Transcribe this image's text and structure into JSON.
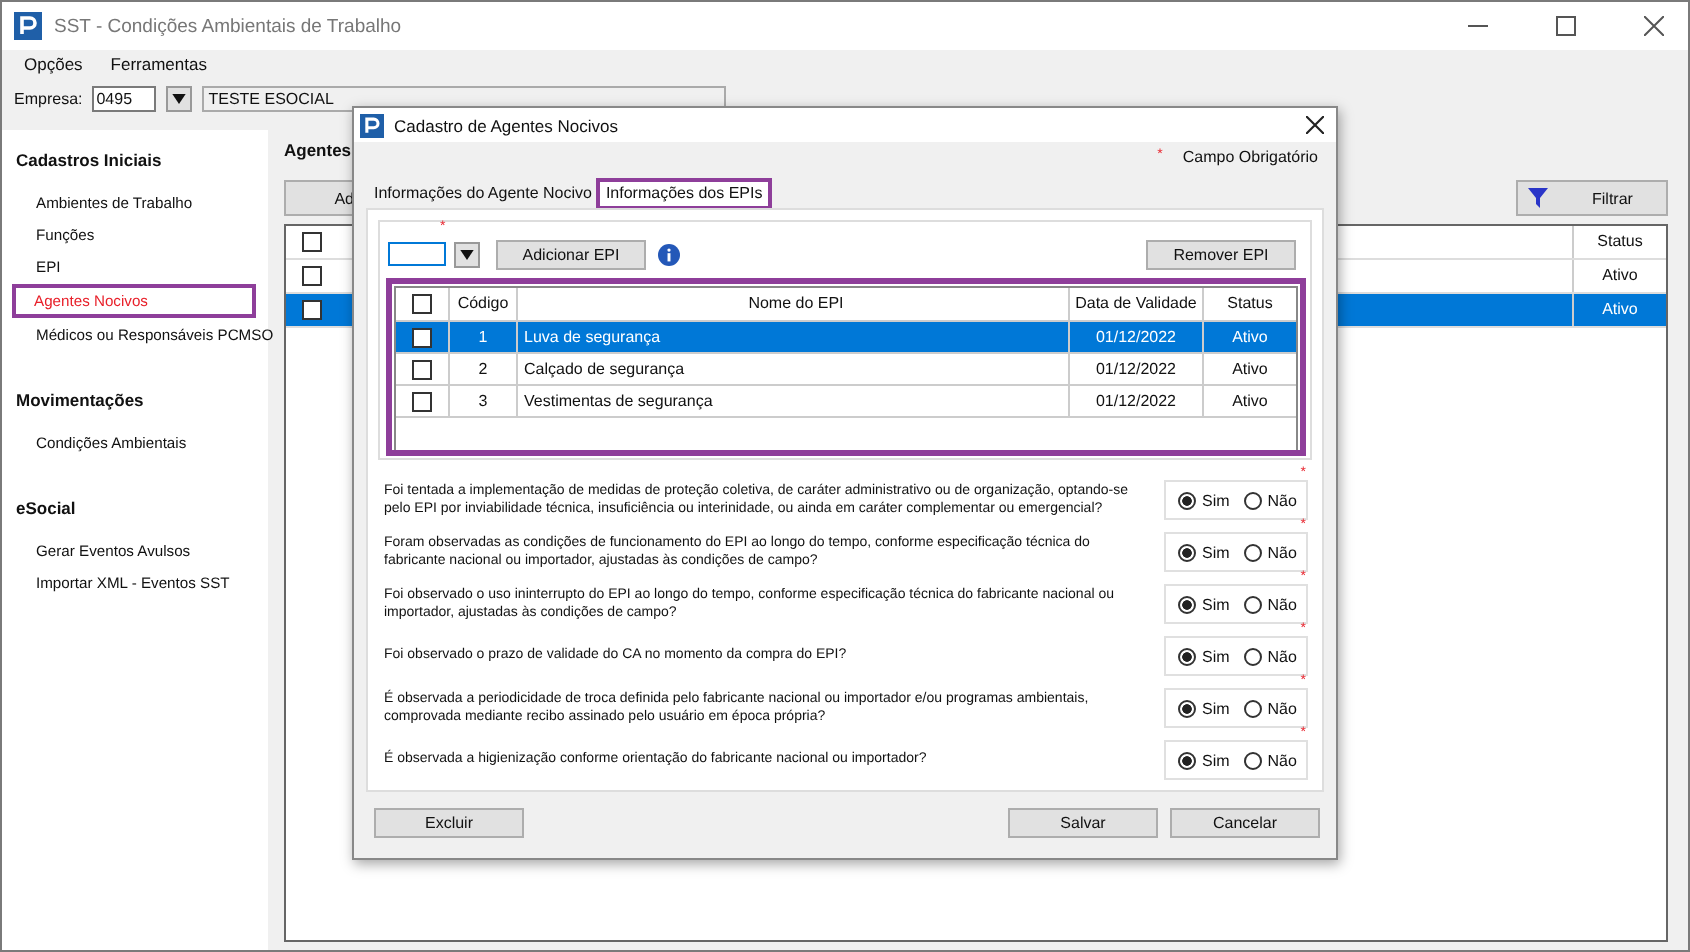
{
  "window": {
    "title": "SST - Condições Ambientais de Trabalho"
  },
  "menu": [
    "Opções",
    "Ferramentas"
  ],
  "company": {
    "label": "Empresa:",
    "code": "0495",
    "name": "TESTE ESOCIAL"
  },
  "sidebar": [
    {
      "heading": "Cadastros Iniciais",
      "items": [
        {
          "label": "Ambientes de Trabalho",
          "selected": false,
          "highlighted": false
        },
        {
          "label": "Funções",
          "selected": false,
          "highlighted": false
        },
        {
          "label": "EPI",
          "selected": false,
          "highlighted": false
        },
        {
          "label": "Agentes Nocivos",
          "selected": true,
          "highlighted": true
        },
        {
          "label": "Médicos ou Responsáveis PCMSO",
          "selected": false,
          "highlighted": false
        }
      ]
    },
    {
      "heading": "Movimentações",
      "items": [
        {
          "label": "Condições Ambientais",
          "selected": false,
          "highlighted": false
        }
      ]
    },
    {
      "heading": "eSocial",
      "items": [
        {
          "label": "Gerar Eventos Avulsos",
          "selected": false,
          "highlighted": false
        },
        {
          "label": "Importar XML - Eventos SST",
          "selected": false,
          "highlighted": false
        }
      ]
    }
  ],
  "main": {
    "heading": "Agentes",
    "add_button": "Ad",
    "filter_button": "Filtrar",
    "table": {
      "status_column": "Status",
      "header_checked": false,
      "rows": [
        {
          "checked": false,
          "status": "Ativo",
          "selected": false
        },
        {
          "checked": false,
          "status": "Ativo",
          "selected": true
        }
      ]
    }
  },
  "dialog": {
    "title": "Cadastro de Agentes Nocivos",
    "required_mark": "*",
    "required_legend": "Campo Obrigatório",
    "tabs": [
      {
        "label": "Informações do Agente Nocivo",
        "selected": false,
        "highlighted": false
      },
      {
        "label": "Informações dos EPIs",
        "selected": true,
        "highlighted": true
      }
    ],
    "epi_field": {
      "required": true
    },
    "add_button": "Adicionar EPI",
    "remove_button": "Remover EPI",
    "epi_table": {
      "highlighted": true,
      "header_checked": false,
      "columns": [
        "Código",
        "Nome do EPI",
        "Data de Validade",
        "Status"
      ],
      "rows": [
        {
          "checked": false,
          "code": "1",
          "name": "Luva de segurança",
          "date": "01/12/2022",
          "status": "Ativo",
          "selected": true
        },
        {
          "checked": false,
          "code": "2",
          "name": "Calçado de segurança",
          "date": "01/12/2022",
          "status": "Ativo",
          "selected": false
        },
        {
          "checked": false,
          "code": "3",
          "name": "Vestimentas de segurança",
          "date": "01/12/2022",
          "status": "Ativo",
          "selected": false
        }
      ]
    },
    "questions": [
      {
        "text": "Foi tentada a implementação de medidas de proteção coletiva, de caráter administrativo ou de organização, optando-se pelo EPI por inviabilidade técnica, insuficiência ou interinidade, ou ainda em caráter complementar ou emergencial?",
        "required": true,
        "options": [
          {
            "label": "Sim",
            "selected": true
          },
          {
            "label": "Não",
            "selected": false
          }
        ]
      },
      {
        "text": "Foram observadas as condições de funcionamento do EPI ao longo do tempo, conforme especificação técnica do fabricante nacional ou importador, ajustadas às condições de campo?",
        "required": true,
        "options": [
          {
            "label": "Sim",
            "selected": true
          },
          {
            "label": "Não",
            "selected": false
          }
        ]
      },
      {
        "text": "Foi observado o uso ininterrupto do EPI ao longo do tempo, conforme especificação técnica do fabricante nacional ou importador, ajustadas às condições de campo?",
        "required": true,
        "options": [
          {
            "label": "Sim",
            "selected": true
          },
          {
            "label": "Não",
            "selected": false
          }
        ]
      },
      {
        "text": "Foi observado o prazo de validade do CA no momento da compra do EPI?",
        "required": true,
        "options": [
          {
            "label": "Sim",
            "selected": true
          },
          {
            "label": "Não",
            "selected": false
          }
        ]
      },
      {
        "text": "É observada a periodicidade de troca definida pelo fabricante nacional ou importador e/ou programas ambientais, comprovada mediante recibo assinado pelo usuário em época própria?",
        "required": true,
        "options": [
          {
            "label": "Sim",
            "selected": true
          },
          {
            "label": "Não",
            "selected": false
          }
        ]
      },
      {
        "text": "É observada a higienização conforme orientação do fabricante nacional ou importador?",
        "required": true,
        "options": [
          {
            "label": "Sim",
            "selected": true
          },
          {
            "label": "Não",
            "selected": false
          }
        ]
      }
    ],
    "buttons": {
      "delete": "Excluir",
      "save": "Salvar",
      "cancel": "Cancelar"
    }
  }
}
